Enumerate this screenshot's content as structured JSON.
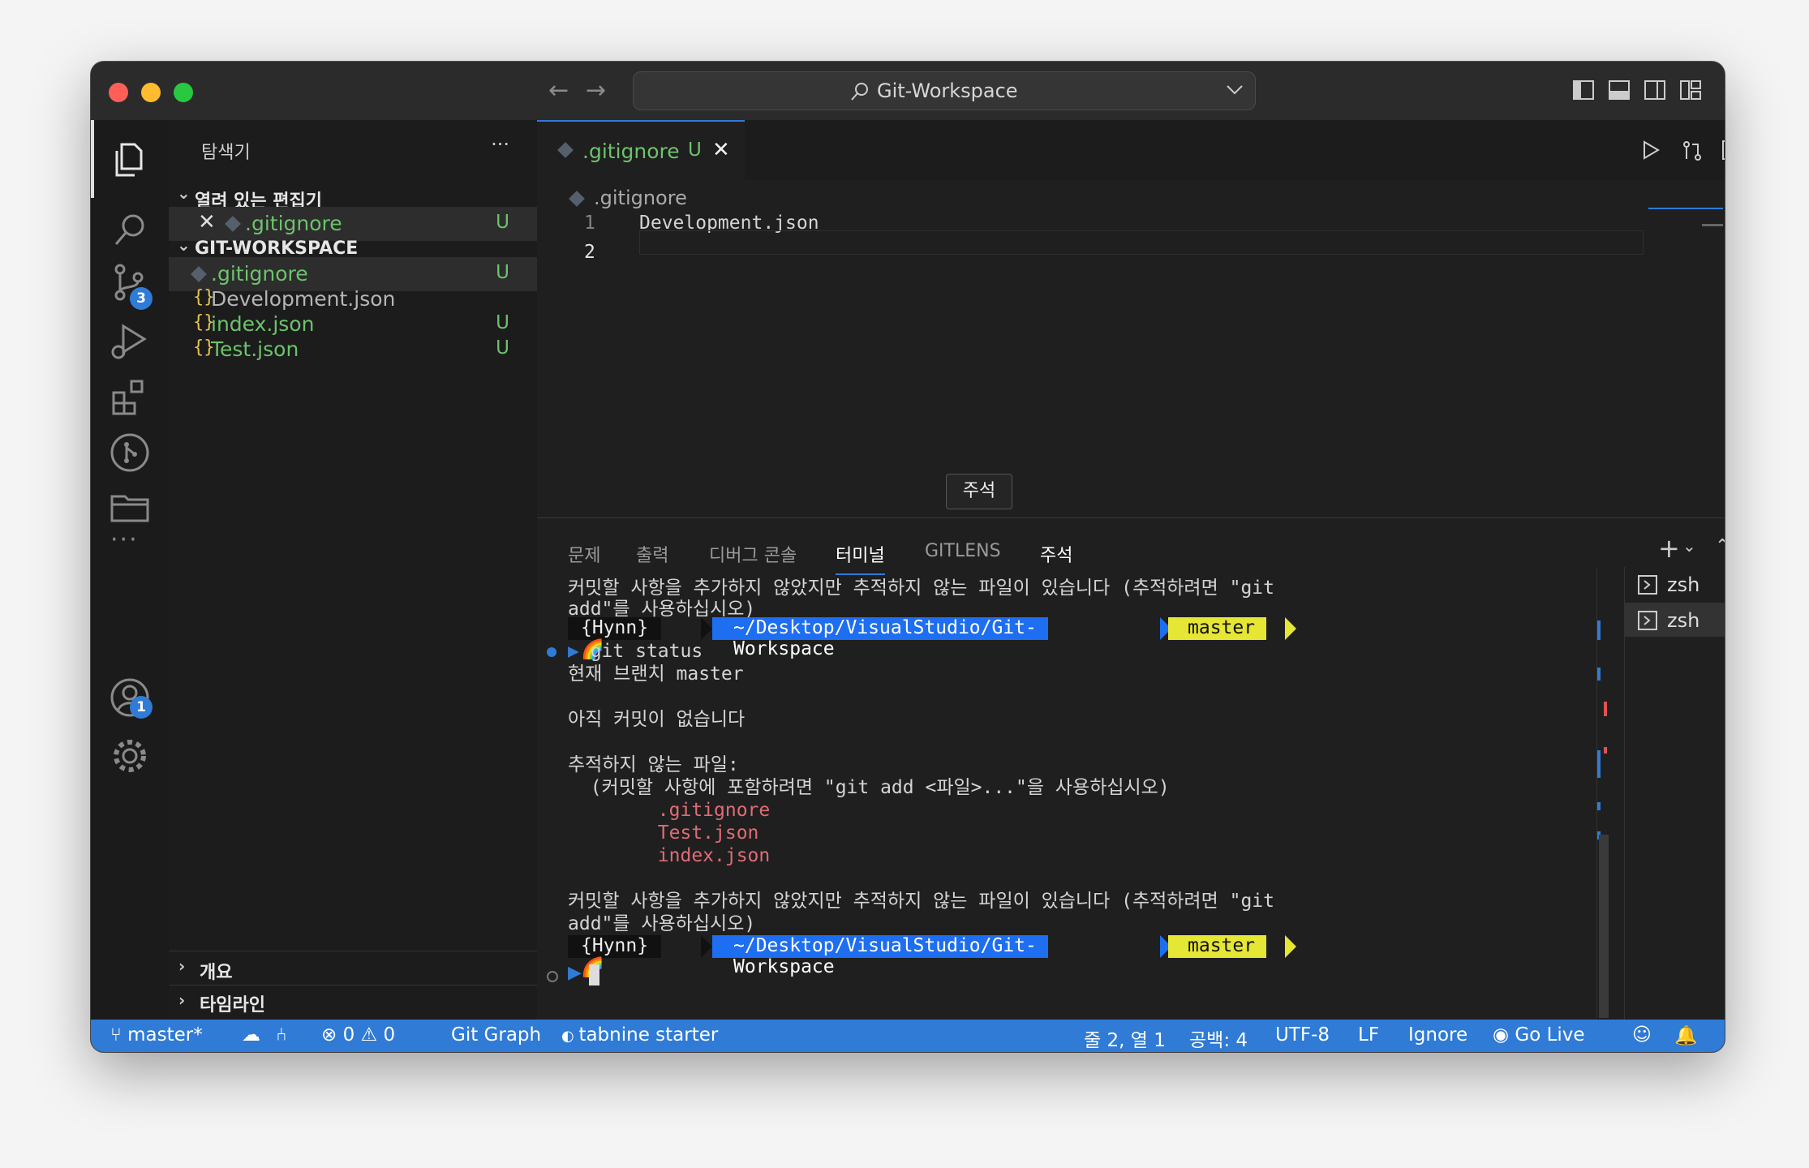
{
  "titlebar": {
    "search_label": "Git-Workspace",
    "colors": {
      "close": "#ff5f57",
      "min": "#febc2e",
      "max": "#28c840"
    }
  },
  "activity": {
    "scm_badge": "3",
    "account_badge": "1"
  },
  "sidebar": {
    "title": "탐색기",
    "more": "···",
    "open_editors": {
      "label": "열려 있는 편집기",
      "items": [
        {
          "name": ".gitignore",
          "status": "U"
        }
      ]
    },
    "workspace": {
      "label": "GIT-WORKSPACE",
      "items": [
        {
          "name": ".gitignore",
          "status": "U"
        },
        {
          "name": "Development.json",
          "status": ""
        },
        {
          "name": "index.json",
          "status": "U"
        },
        {
          "name": "Test.json",
          "status": "U"
        }
      ]
    },
    "outline": "개요",
    "timeline": "타임라인"
  },
  "editor": {
    "tab": {
      "name": ".gitignore",
      "status": "U"
    },
    "breadcrumb": ".gitignore",
    "lines": [
      {
        "num": "1",
        "text": "Development.json"
      },
      {
        "num": "2",
        "text": ""
      }
    ]
  },
  "tooltip": "주석",
  "panel": {
    "tabs": [
      "문제",
      "출력",
      "디버그 콘솔",
      "터미널",
      "GITLENS",
      "주석"
    ],
    "active_tab": "터미널",
    "terminals": [
      "zsh",
      "zsh"
    ],
    "terminal": {
      "line1": "커밋할 사항을 추가하지 않았지만 추적하지 않는 파일이 있습니다 (추적하려면 \"git",
      "line2": "add\"를 사용하십시오)",
      "prompt_user": "{Hynn} 🌈",
      "prompt_path": "~/Desktop/VisualStudio/Git-Workspace",
      "prompt_branch": " master",
      "command": "git status",
      "out1": "현재 브랜치 master",
      "out2": "아직 커밋이 없습니다",
      "out3": "추적하지 않는 파일:",
      "out4": "  (커밋할 사항에 포함하려면 \"git add <파일>...\"을 사용하십시오)",
      "files": [
        "        .gitignore",
        "        Test.json",
        "        index.json"
      ],
      "line3": "커밋할 사항을 추가하지 않았지만 추적하지 않는 파일이 있습니다 (추적하려면 \"git",
      "line4": "add\"를 사용하십시오)",
      "prompt2_user": "{Hynn} 🌈",
      "prompt2_path": "~/Desktop/VisualStudio/Git-Workspace",
      "prompt2_branch": " master"
    }
  },
  "statusbar": {
    "branch": "master*",
    "errors": "0",
    "warnings": "0",
    "git_graph": "Git Graph",
    "tabnine": "tabnine starter",
    "position": "줄 2, 열 1",
    "spaces": "공백: 4",
    "encoding": "UTF-8",
    "eol": "LF",
    "language": "Ignore",
    "golive": "Go Live"
  }
}
